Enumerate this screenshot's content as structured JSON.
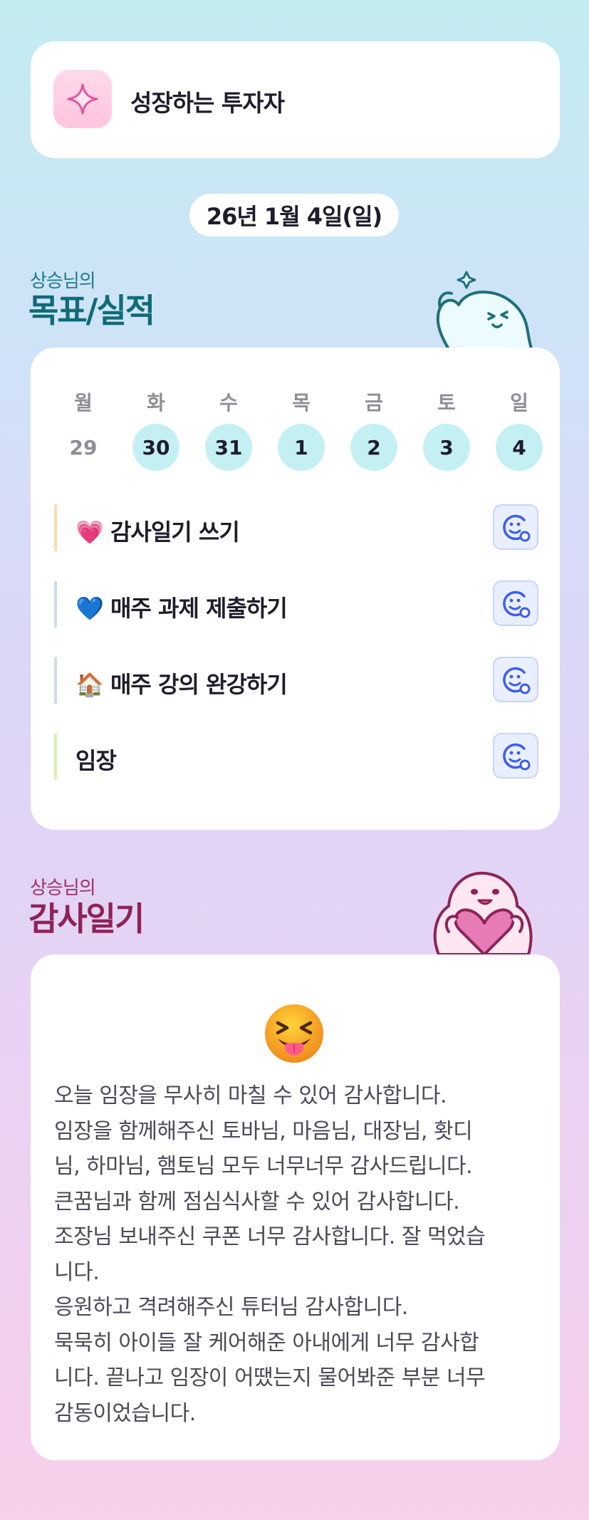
{
  "header": {
    "title": "성장하는 투자자",
    "icon": "sparkle-icon"
  },
  "date": "26년 1월 4일(일)",
  "goals_section": {
    "subtitle": "상승님의",
    "title": "목표/실적"
  },
  "calendar": {
    "weekdays": [
      "월",
      "화",
      "수",
      "목",
      "금",
      "토",
      "일"
    ],
    "days": [
      "29",
      "30",
      "31",
      "1",
      "2",
      "3",
      "4"
    ]
  },
  "goals": [
    {
      "emoji": "💗",
      "label": "감사일기 쓰기",
      "bar_color": "#f8dcae"
    },
    {
      "emoji": "💙",
      "label": "매주 과제 제출하기",
      "bar_color": "#cfdcee"
    },
    {
      "emoji": "🏠",
      "label": "매주 강의 완강하기",
      "bar_color": "#cfdcee"
    },
    {
      "emoji": "",
      "label": "임장",
      "bar_color": "#d7f0b0"
    }
  ],
  "diary_section": {
    "subtitle": "상승님의",
    "title": "감사일기"
  },
  "diary": {
    "emoji": "squinting-tongue-face",
    "lines": [
      "오늘 임장을 무사히 마칠 수 있어 감사합니다.",
      "임장을 함께해주신 토바님, 마음님, 대장님, 홧디",
      "님, 하마님, 햄토님 모두 너무너무 감사드립니다.",
      "큰꿈님과 함께 점심식사할 수 있어 감사합니다.",
      "조장님 보내주신 쿠폰 너무 감사합니다. 잘 먹었습",
      "니다.",
      "응원하고 격려해주신 튜터님 감사합니다.",
      "묵묵히 아이들 잘 케어해준 아내에게 너무 감사합",
      "니다. 끝나고 임장이 어땠는지 물어봐준 부분 너무",
      "감동이었습니다."
    ]
  },
  "colors": {
    "accent_teal": "#0f6b78",
    "accent_pink": "#8e2357",
    "day_fill": "#c5f0f3"
  }
}
